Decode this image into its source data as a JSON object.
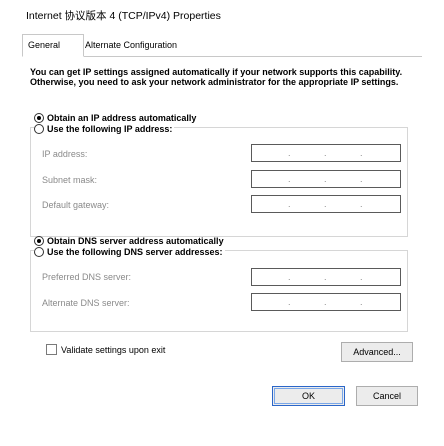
{
  "window": {
    "title": "Internet 协议版本 4 (TCP/IPv4) Properties"
  },
  "tabs": [
    {
      "label": "General",
      "active": true
    },
    {
      "label": "Alternate Configuration",
      "active": false
    }
  ],
  "description": "You can get IP settings assigned automatically if your network supports this capability. Otherwise, you need to ask your network administrator for the appropriate IP settings.",
  "ip_section": {
    "auto_label": "Obtain an IP address automatically",
    "auto_selected": true,
    "manual_label": "Use the following IP address:",
    "manual_selected": false,
    "fields": [
      {
        "label": "IP address:",
        "value": ""
      },
      {
        "label": "Subnet mask:",
        "value": ""
      },
      {
        "label": "Default gateway:",
        "value": ""
      }
    ]
  },
  "dns_section": {
    "auto_label": "Obtain DNS server address automatically",
    "auto_selected": true,
    "manual_label": "Use the following DNS server addresses:",
    "manual_selected": false,
    "fields": [
      {
        "label": "Preferred DNS server:",
        "value": ""
      },
      {
        "label": "Alternate DNS server:",
        "value": ""
      }
    ]
  },
  "validate": {
    "label": "Validate settings upon exit",
    "checked": false
  },
  "buttons": {
    "advanced": "Advanced...",
    "ok": "OK",
    "cancel": "Cancel"
  },
  "ip_separator": "."
}
